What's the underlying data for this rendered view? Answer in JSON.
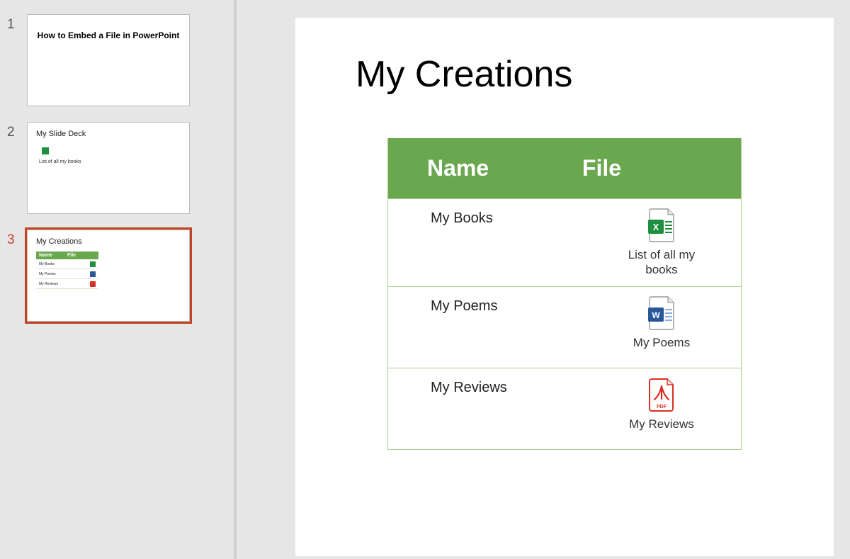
{
  "thumbnails": [
    {
      "number": "1",
      "title": "How to Embed a File in PowerPoint"
    },
    {
      "number": "2",
      "title": "My Slide Deck",
      "caption": "List of all my books"
    },
    {
      "number": "3",
      "title": "My Creations",
      "header_name": "Name",
      "header_file": "File",
      "rows": [
        "My Books",
        "My Poems",
        "My Reviews"
      ]
    }
  ],
  "selected_thumb": 3,
  "slide": {
    "title": "My Creations",
    "header_name": "Name",
    "header_file": "File",
    "rows": [
      {
        "name": "My Books",
        "icon": "excel",
        "caption": "List of all my books"
      },
      {
        "name": "My Poems",
        "icon": "word",
        "caption": "My Poems"
      },
      {
        "name": "My Reviews",
        "icon": "pdf",
        "caption": "My Reviews"
      }
    ]
  },
  "colors": {
    "table_header": "#6aa84f",
    "table_border": "#a8d08d",
    "selection": "#c44324",
    "excel": "#1d8f3f",
    "word": "#2a579a",
    "pdf": "#d93025"
  }
}
